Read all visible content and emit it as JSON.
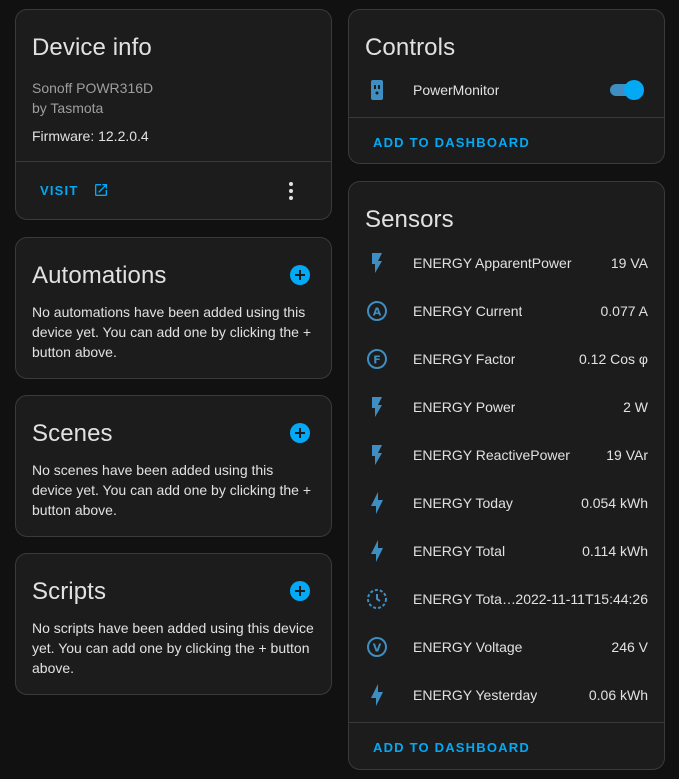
{
  "device_info": {
    "title": "Device info",
    "model": "Sonoff POWR316D",
    "manufacturer": "by Tasmota",
    "firmware": "Firmware: 12.2.0.4",
    "visit_label": "VISIT"
  },
  "automations": {
    "title": "Automations",
    "text": "No automations have been added using this device yet. You can add one by clicking the + button above."
  },
  "scenes": {
    "title": "Scenes",
    "text": "No scenes have been added using this device yet. You can add one by clicking the + button above."
  },
  "scripts": {
    "title": "Scripts",
    "text": "No scripts have been added using this device yet. You can add one by clicking the + button above."
  },
  "controls": {
    "title": "Controls",
    "items": [
      {
        "name": "PowerMonitor",
        "icon": "power-plug-icon",
        "state": "on"
      }
    ],
    "add_label": "ADD TO DASHBOARD"
  },
  "sensors": {
    "title": "Sensors",
    "items": [
      {
        "name": "ENERGY ApparentPower",
        "value": "19 VA",
        "icon": "flash-icon"
      },
      {
        "name": "ENERGY Current",
        "value": "0.077 A",
        "icon": "alpha-a-circle-icon"
      },
      {
        "name": "ENERGY Factor",
        "value": "0.12 Cos φ",
        "icon": "alpha-f-circle-icon"
      },
      {
        "name": "ENERGY Power",
        "value": "2 W",
        "icon": "flash-icon"
      },
      {
        "name": "ENERGY ReactivePower",
        "value": "19 VAr",
        "icon": "flash-icon"
      },
      {
        "name": "ENERGY Today",
        "value": "0.054 kWh",
        "icon": "lightning-bolt-icon"
      },
      {
        "name": "ENERGY Total",
        "value": "0.114 kWh",
        "icon": "lightning-bolt-icon"
      },
      {
        "name": "ENERGY Tota…",
        "value": "2022-11-11T15:44:26",
        "icon": "clock-outline-icon"
      },
      {
        "name": "ENERGY Voltage",
        "value": "246 V",
        "icon": "alpha-v-circle-icon"
      },
      {
        "name": "ENERGY Yesterday",
        "value": "0.06 kWh",
        "icon": "lightning-bolt-icon"
      }
    ],
    "add_label": "ADD TO DASHBOARD"
  },
  "colors": {
    "accent": "#03a9f4",
    "icon": "#3e8ec2",
    "card": "#1c1c1c",
    "background": "#111111"
  }
}
